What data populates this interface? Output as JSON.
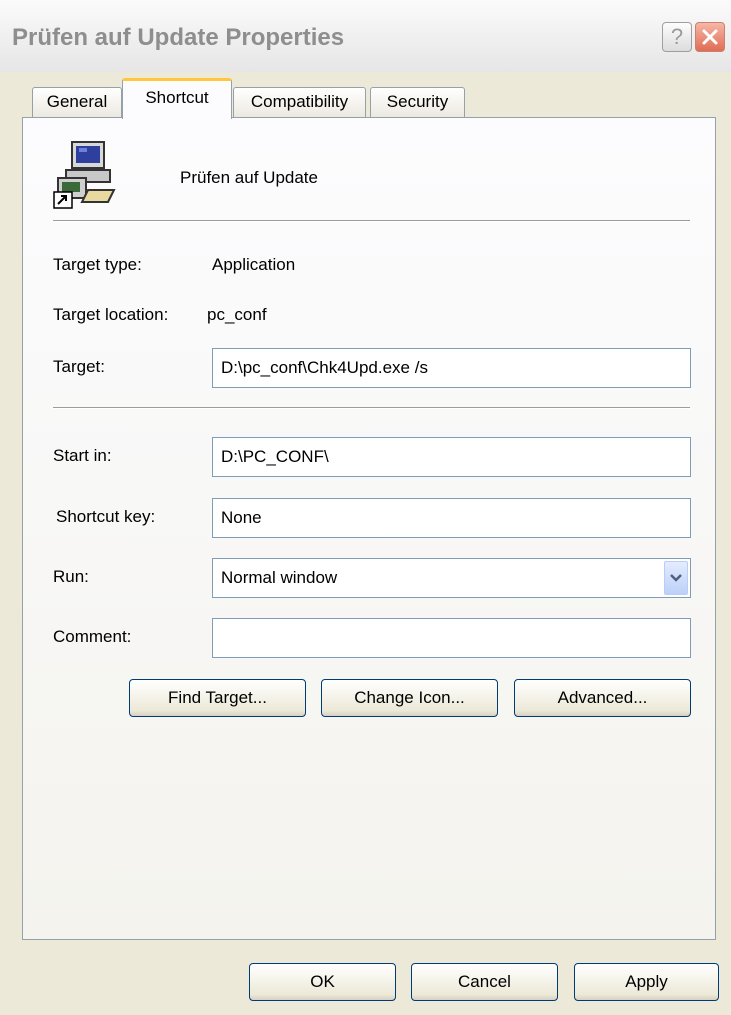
{
  "window": {
    "title": "Prüfen auf Update Properties"
  },
  "titlebar_buttons": {
    "help": "?",
    "close_icon": "close-icon"
  },
  "tabs": [
    {
      "label": "General",
      "active": false
    },
    {
      "label": "Shortcut",
      "active": true
    },
    {
      "label": "Compatibility",
      "active": false
    },
    {
      "label": "Security",
      "active": false
    }
  ],
  "shortcut": {
    "icon": "application-shortcut-icon",
    "name": "Prüfen auf Update",
    "target_type_label": "Target type:",
    "target_type_value": "Application",
    "target_location_label": "Target location:",
    "target_location_value": "pc_conf",
    "target_label": "Target:",
    "target_value": "D:\\pc_conf\\Chk4Upd.exe /s",
    "start_in_label": "Start in:",
    "start_in_value": "D:\\PC_CONF\\",
    "shortcut_key_label": "Shortcut key:",
    "shortcut_key_value": "None",
    "run_label": "Run:",
    "run_value": "Normal window",
    "comment_label": "Comment:",
    "comment_value": ""
  },
  "buttons": {
    "find_target": "Find Target...",
    "change_icon": "Change Icon...",
    "advanced": "Advanced...",
    "ok": "OK",
    "cancel": "Cancel",
    "apply": "Apply"
  },
  "colors": {
    "dialog_bg": "#ece9d8",
    "panel_bg": "#fcfcfe",
    "active_tab_accent": "#ffc83c",
    "button_border": "#003c74",
    "field_border": "#7f9db9"
  }
}
